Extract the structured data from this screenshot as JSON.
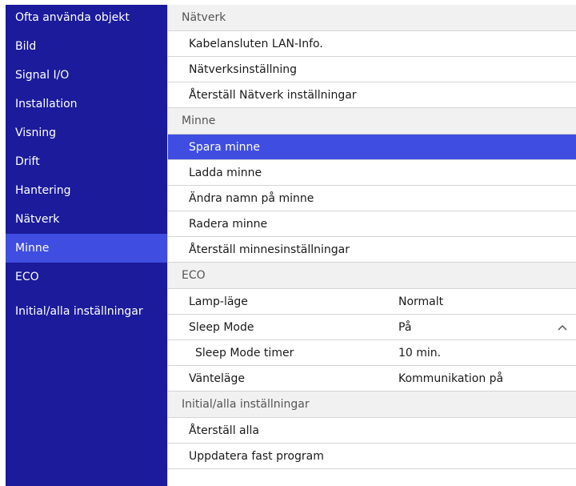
{
  "sidebar": {
    "items": [
      {
        "label": "Ofta använda objekt"
      },
      {
        "label": "Bild"
      },
      {
        "label": "Signal I/O"
      },
      {
        "label": "Installation"
      },
      {
        "label": "Visning"
      },
      {
        "label": "Drift"
      },
      {
        "label": "Hantering"
      },
      {
        "label": "Nätverk"
      },
      {
        "label": "Minne"
      },
      {
        "label": "ECO"
      },
      {
        "label": "Initial/alla inställningar"
      }
    ],
    "active": "Minne"
  },
  "main": {
    "network": {
      "header": "Nätverk",
      "items": [
        "Kabelansluten LAN-Info.",
        "Nätverksinställning",
        "Återställ Nätverk inställningar"
      ]
    },
    "memory": {
      "header": "Minne",
      "items": [
        "Spara minne",
        "Ladda minne",
        "Ändra namn på minne",
        "Radera minne",
        "Återställ minnesinställningar"
      ],
      "selected": "Spara minne"
    },
    "eco": {
      "header": "ECO",
      "lamp_mode": {
        "label": "Lamp-läge",
        "value": "Normalt"
      },
      "sleep_mode": {
        "label": "Sleep Mode",
        "value": "På"
      },
      "sleep_timer": {
        "label": "Sleep Mode timer",
        "value": "10 min."
      },
      "standby": {
        "label": "Vänteläge",
        "value": "Kommunikation på"
      }
    },
    "initial": {
      "header": "Initial/alla inställningar",
      "items": [
        "Återställ alla",
        "Uppdatera fast program"
      ]
    }
  },
  "icons": {
    "sleep_mode_expander": "chevron-up-icon"
  },
  "colors": {
    "sidebar_bg": "#1b1b9b",
    "highlight": "#3f4de0",
    "section_header_bg": "#f1f1f1"
  }
}
